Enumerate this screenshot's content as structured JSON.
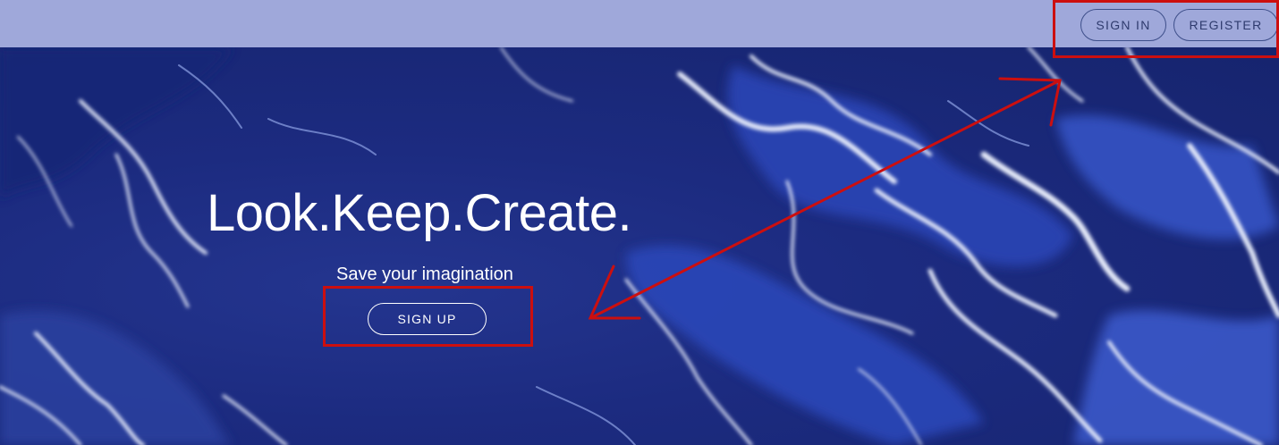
{
  "header": {
    "sign_in_label": "SIGN IN",
    "register_label": "REGISTER"
  },
  "hero": {
    "headline": "Look.Keep.Create.",
    "tagline": "Save your imagination",
    "sign_up_label": "SIGN UP"
  },
  "colors": {
    "topbar_bg": "#9fa8da",
    "hero_bg": "#1f2f8a",
    "annotation": "#cc0f0f"
  }
}
